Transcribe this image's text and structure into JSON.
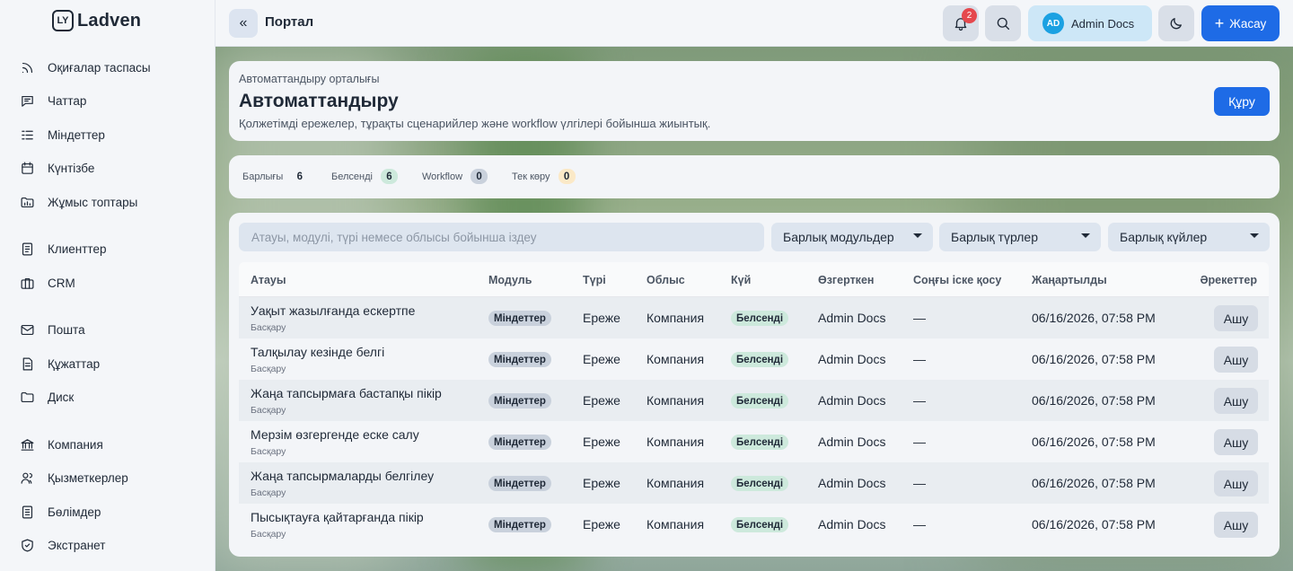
{
  "app": {
    "logo_mark": "LY",
    "name": "Ladven"
  },
  "sidebar": {
    "items": [
      {
        "label": "Оқиғалар таспасы",
        "icon": "rss-icon"
      },
      {
        "label": "Чаттар",
        "icon": "chat-icon"
      },
      {
        "label": "Міндеттер",
        "icon": "tasks-icon"
      },
      {
        "label": "Күнтізбе",
        "icon": "calendar-icon"
      },
      {
        "label": "Жұмыс топтары",
        "icon": "folder-icon"
      },
      {
        "label": "Клиенттер",
        "icon": "contacts-icon"
      },
      {
        "label": "CRM",
        "icon": "briefcase-icon"
      },
      {
        "label": "Пошта",
        "icon": "mail-icon"
      },
      {
        "label": "Құжаттар",
        "icon": "document-icon"
      },
      {
        "label": "Диск",
        "icon": "disk-folder-icon"
      },
      {
        "label": "Компания",
        "icon": "bank-icon"
      },
      {
        "label": "Қызметкерлер",
        "icon": "users-icon"
      },
      {
        "label": "Бөлімдер",
        "icon": "departments-icon"
      },
      {
        "label": "Экстранет",
        "icon": "shield-icon"
      }
    ]
  },
  "topbar": {
    "collapse_label": "«",
    "title": "Портал",
    "notifications_count": "2",
    "user_initials": "AD",
    "user_name": "Admin Docs",
    "create_label": "Жасау"
  },
  "header": {
    "eyebrow": "Автоматтандыру орталығы",
    "title": "Автоматтандыру",
    "description": "Қолжетімді ережелер, тұрақты сценарийлер және workflow үлгілері бойынша жиынтық.",
    "build_label": "Құру"
  },
  "stats": [
    {
      "label": "Барлығы",
      "count": "6",
      "color": "#f3f5f8"
    },
    {
      "label": "Белсенді",
      "count": "6",
      "color": "#cde9dc"
    },
    {
      "label": "Workflow",
      "count": "0",
      "color": "#c9d1dc"
    },
    {
      "label": "Тек көру",
      "count": "0",
      "color": "#fbe9c7"
    }
  ],
  "filters": {
    "search_placeholder": "Атауы, модулі, түрі немесе облысы бойынша іздеу",
    "modules": "Барлық модульдер",
    "types": "Барлық түрлер",
    "states": "Барлық күйлер"
  },
  "table": {
    "headers": {
      "name": "Атауы",
      "module": "Модуль",
      "type": "Түрі",
      "scope": "Облыс",
      "state": "Күй",
      "modified_by": "Өзгерткен",
      "last_run": "Соңғы іске қосу",
      "updated": "Жаңартылды",
      "actions": "Әрекеттер"
    },
    "rows": [
      {
        "name": "Уақыт жазылғанда ескертпе",
        "sub": "Басқару",
        "module": "Міндеттер",
        "type": "Ереже",
        "scope": "Компания",
        "state": "Белсенді",
        "modified_by": "Admin Docs",
        "last_run": "—",
        "updated": "06/16/2026, 07:58 PM",
        "action": "Ашу"
      },
      {
        "name": "Талқылау кезінде белгі",
        "sub": "Басқару",
        "module": "Міндеттер",
        "type": "Ереже",
        "scope": "Компания",
        "state": "Белсенді",
        "modified_by": "Admin Docs",
        "last_run": "—",
        "updated": "06/16/2026, 07:58 PM",
        "action": "Ашу"
      },
      {
        "name": "Жаңа тапсырмаға бастапқы пікір",
        "sub": "Басқару",
        "module": "Міндеттер",
        "type": "Ереже",
        "scope": "Компания",
        "state": "Белсенді",
        "modified_by": "Admin Docs",
        "last_run": "—",
        "updated": "06/16/2026, 07:58 PM",
        "action": "Ашу"
      },
      {
        "name": "Мерзім өзгергенде еске салу",
        "sub": "Басқару",
        "module": "Міндеттер",
        "type": "Ереже",
        "scope": "Компания",
        "state": "Белсенді",
        "modified_by": "Admin Docs",
        "last_run": "—",
        "updated": "06/16/2026, 07:58 PM",
        "action": "Ашу"
      },
      {
        "name": "Жаңа тапсырмаларды белгілеу",
        "sub": "Басқару",
        "module": "Міндеттер",
        "type": "Ереже",
        "scope": "Компания",
        "state": "Белсенді",
        "modified_by": "Admin Docs",
        "last_run": "—",
        "updated": "06/16/2026, 07:58 PM",
        "action": "Ашу"
      },
      {
        "name": "Пысықтауға қайтарғанда пікір",
        "sub": "Басқару",
        "module": "Міндеттер",
        "type": "Ереже",
        "scope": "Компания",
        "state": "Белсенді",
        "modified_by": "Admin Docs",
        "last_run": "—",
        "updated": "06/16/2026, 07:58 PM",
        "action": "Ашу"
      }
    ]
  }
}
